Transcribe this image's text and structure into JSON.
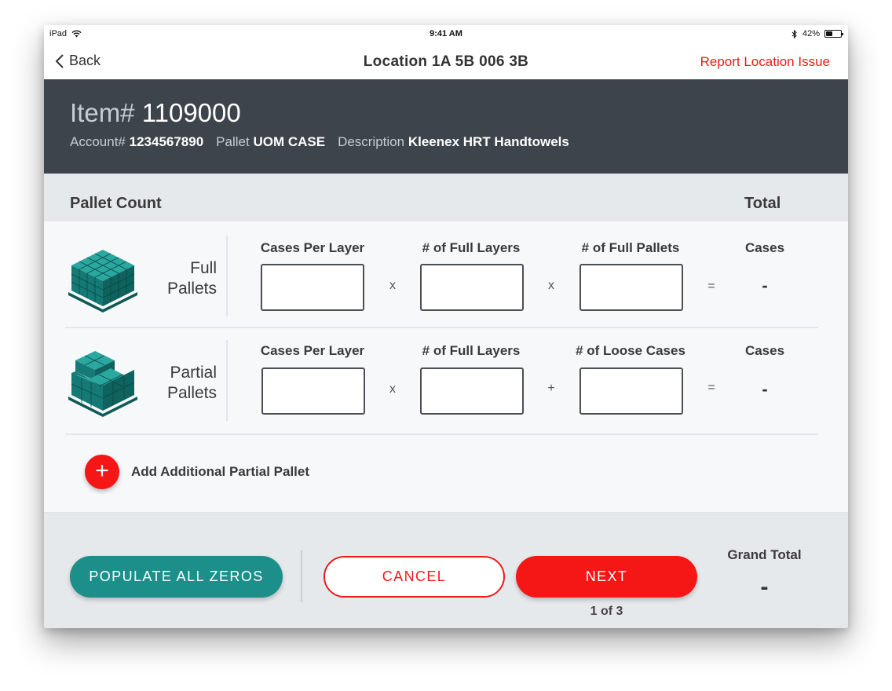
{
  "status_bar": {
    "device": "iPad",
    "time": "9:41 AM",
    "battery": "42%",
    "battery_level": 0.42
  },
  "nav": {
    "back_label": "Back",
    "title": "Location 1A 5B 006 3B",
    "report_label": "Report Location Issue"
  },
  "item": {
    "item_label": "Item#",
    "item_number": "1109000",
    "account_label": "Account#",
    "account_value": "1234567890",
    "pallet_label": "Pallet",
    "pallet_value": "UOM CASE",
    "description_label": "Description",
    "description_value": "Kleenex HRT Handtowels"
  },
  "section": {
    "title": "Pallet Count",
    "total_title": "Total"
  },
  "rows": [
    {
      "label_line1": "Full",
      "label_line2": "Pallets",
      "col1": "Cases Per Layer",
      "col2": "# of Full Layers",
      "col3": "# of Full Pallets",
      "op1": "x",
      "op2": "x",
      "eq": "=",
      "input1": "",
      "input2": "",
      "input3": "",
      "total_label": "Cases",
      "total_value": "-"
    },
    {
      "label_line1": "Partial",
      "label_line2": "Pallets",
      "col1": "Cases Per Layer",
      "col2": "# of Full Layers",
      "col3": "# of Loose Cases",
      "op1": "x",
      "op2": "+",
      "eq": "=",
      "input1": "",
      "input2": "",
      "input3": "",
      "total_label": "Cases",
      "total_value": "-"
    }
  ],
  "add_partial": {
    "icon": "+",
    "label": "Add Additional Partial Pallet"
  },
  "footer": {
    "populate_label": "POPULATE ALL ZEROS",
    "cancel_label": "CANCEL",
    "next_label": "NEXT",
    "page_indicator": "1 of 3",
    "grand_total_label": "Grand Total",
    "grand_total_value": "-"
  },
  "colors": {
    "accent_red": "#f51616",
    "teal": "#1d8f8a",
    "header_dark": "#3d444c",
    "pallet_teal": "#1a8a86"
  }
}
